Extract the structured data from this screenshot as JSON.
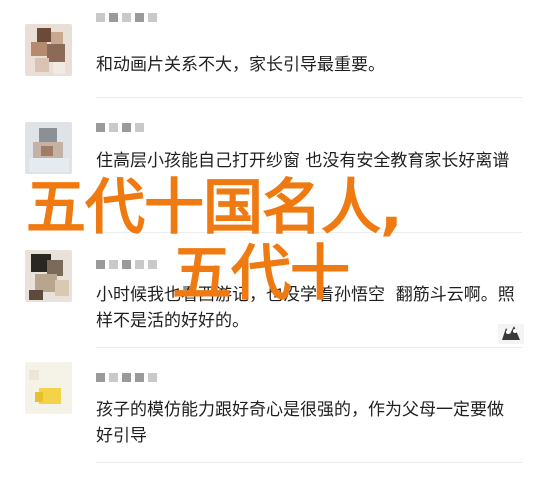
{
  "comments": [
    {
      "text": "和动画片关系不大，家长引导最重要。"
    },
    {
      "text": "住高层小孩能自己打开纱窗 也没有安全教育家长好离谱"
    },
    {
      "text": "小时候我也看西游记，也没学着孙悟空  翻筋斗云啊。照样不是活的好好的。"
    },
    {
      "text": "孩子的模仿能力跟好奇心是很强的，作为父母一定要做好引导"
    }
  ],
  "overlay": {
    "line1": "五代十国名人,",
    "line2": "五代十"
  },
  "colors": {
    "overlay_text": "#f07a12",
    "divider": "#ececec"
  },
  "icons": {
    "sticker": "cartoon-sticker-icon"
  }
}
